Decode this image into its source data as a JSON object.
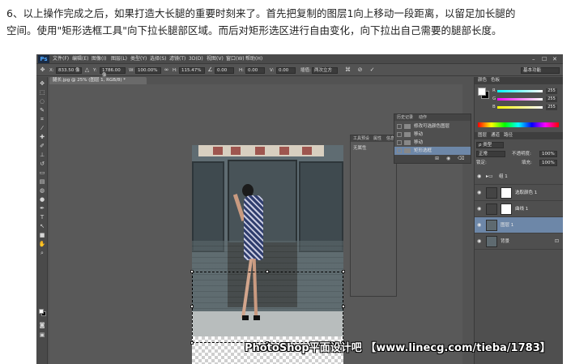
{
  "article": {
    "line1": "6、以上操作完成之后，如果打造大长腿的重要时刻来了。首先把复制的图层1向上移动一段距离，以留足加长腿的",
    "line2": "空间。使用\"矩形选框工具\"向下拉长腿部区域。而后对矩形选区进行自由变化，向下拉出自己需要的腿部长度。"
  },
  "app": {
    "logo": "Ps",
    "menu": [
      "文件(F)",
      "编辑(E)",
      "图像(I)",
      "图层(L)",
      "类型(Y)",
      "选择(S)",
      "滤镜(T)",
      "3D(D)",
      "视图(V)",
      "窗口(W)",
      "帮助(H)"
    ],
    "window_controls": [
      "–",
      "☐",
      "✕"
    ]
  },
  "options": {
    "x_label": "X:",
    "x_value": "833.50 像",
    "y_label": "Y:",
    "y_value": "1786.00 像",
    "w_label": "W:",
    "w_value": "100.00%",
    "h_label": "H:",
    "h_value": "115.47%",
    "angle_value": "0.00",
    "h_skew_label": "H:",
    "h_skew_value": "0.00",
    "v_skew_label": "V:",
    "v_skew_value": "0.00",
    "interp_label": "插值:",
    "interp_value": "两次立方",
    "workspace": "基本功能"
  },
  "document": {
    "tab": "腿长.jpg @ 25% (图层 1, RGB/8) *"
  },
  "photo": {
    "watermark": "PhotoShop平面设计吧 【www.linecg.com/tieba/1783】"
  },
  "properties": {
    "tabs": [
      "工具预设",
      "属性",
      "信息"
    ],
    "body": "无属性"
  },
  "history": {
    "tabs": [
      "历史记录",
      "动作"
    ],
    "rows": [
      "修改可选颜色图层",
      "移动",
      "移动",
      "矩形选框"
    ],
    "active_index": 3
  },
  "color_panel": {
    "tabs": [
      "颜色",
      "色板"
    ],
    "r_label": "R",
    "g_label": "G",
    "b_label": "B",
    "r_value": "255",
    "g_value": "255",
    "b_value": "255",
    "fg_color": "#ffffff",
    "bg_color": "#000000"
  },
  "layers": {
    "tabs": [
      "图层",
      "通道",
      "路径"
    ],
    "filter_label": "ρ 类型",
    "blend_mode": "正常",
    "opacity_label": "不透明度:",
    "opacity_value": "100%",
    "lock_label": "锁定:",
    "fill_label": "填充:",
    "fill_value": "100%",
    "rows": [
      {
        "name": "组 1",
        "type": "group"
      },
      {
        "name": "选取颜色 1",
        "type": "adjustment"
      },
      {
        "name": "曲线 1",
        "type": "adjustment"
      },
      {
        "name": "图层 1",
        "type": "pixel"
      },
      {
        "name": "背景",
        "type": "background"
      }
    ],
    "active_index": 3
  },
  "colors": {
    "selection_highlight": "#6d87a8",
    "ps_background": "#535353"
  }
}
